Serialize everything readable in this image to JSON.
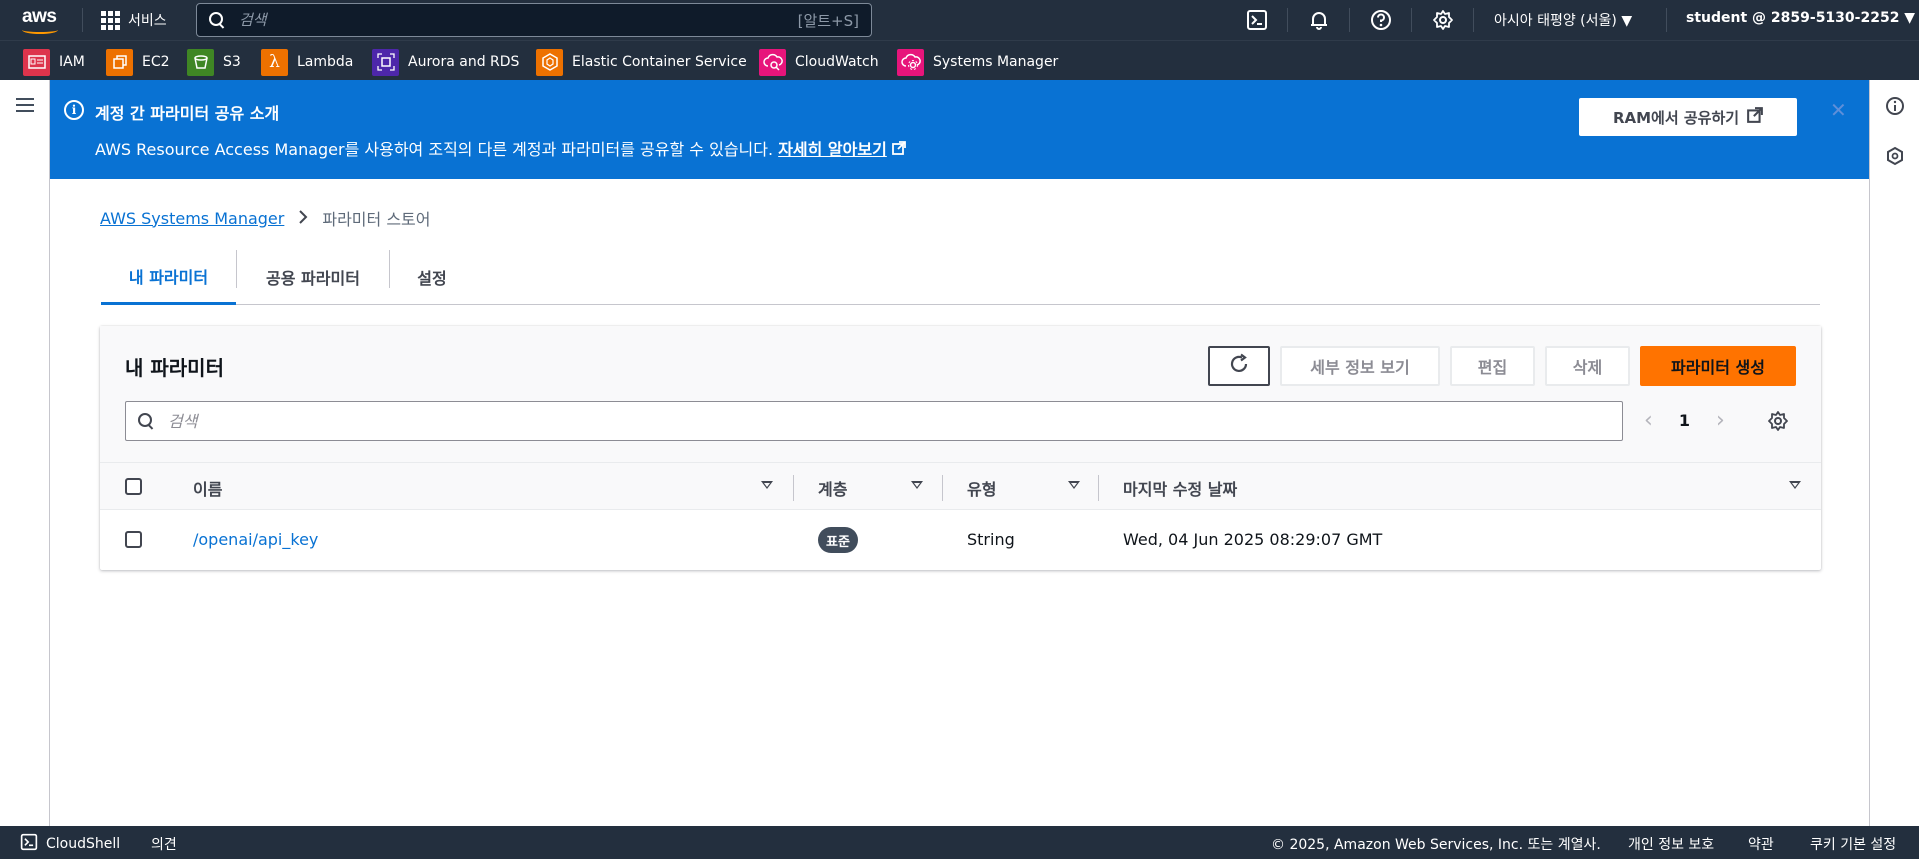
{
  "topnav": {
    "logo_text": "aws",
    "services_label": "서비스",
    "search_placeholder": "검색",
    "search_shortcut": "[알트+S]",
    "region": "아시아 태평양 (서울) ▼",
    "account": "student @ 2859-5130-2252 ▼",
    "icons": [
      "cloudshell-icon",
      "notifications-icon",
      "help-icon",
      "settings-icon"
    ]
  },
  "favorites": [
    {
      "label": "IAM",
      "color": "#dd344c"
    },
    {
      "label": "EC2",
      "color": "#ed7100"
    },
    {
      "label": "S3",
      "color": "#3f8624"
    },
    {
      "label": "Lambda",
      "color": "#ed7100"
    },
    {
      "label": "Aurora and RDS",
      "color": "#4d27aa"
    },
    {
      "label": "Elastic Container Service",
      "color": "#ed7100"
    },
    {
      "label": "CloudWatch",
      "color": "#e7157b"
    },
    {
      "label": "Systems Manager",
      "color": "#e7157b"
    }
  ],
  "flash": {
    "title": "계정 간 파라미터 공유 소개",
    "message": "AWS Resource Access Manager를 사용하여 조직의 다른 계정과 파라미터를 공유할 수 있습니다.",
    "link": "자세히 알아보기",
    "button": "RAM에서 공유하기",
    "color": "#0972d3"
  },
  "breadcrumb": {
    "root": "AWS Systems Manager",
    "current": "파라미터 스토어"
  },
  "tabs": [
    {
      "label": "내 파라미터",
      "active": true
    },
    {
      "label": "공용 파라미터",
      "active": false
    },
    {
      "label": "설정",
      "active": false
    }
  ],
  "panel": {
    "title": "내 파라미터",
    "buttons": {
      "details": "세부 정보 보기",
      "edit": "편집",
      "delete": "삭제",
      "create": "파라미터 생성"
    },
    "search_placeholder": "검색",
    "page": "1",
    "columns": {
      "name": "이름",
      "tier": "계층",
      "type": "유형",
      "modified": "마지막 수정 날짜"
    },
    "rows": [
      {
        "name": "/openai/api_key",
        "tier": "표준",
        "type": "String",
        "modified": "Wed, 04 Jun 2025 08:29:07 GMT"
      }
    ]
  },
  "footer": {
    "cloudshell": "CloudShell",
    "feedback": "의견",
    "copyright": "© 2025, Amazon Web Services, Inc. 또는 계열사.",
    "privacy": "개인 정보 보호",
    "terms": "약관",
    "cookies": "쿠키 기본 설정"
  },
  "colors": {
    "nav_bg": "#232f3e",
    "primary_button": "#ff7300",
    "link": "#0972d3"
  }
}
